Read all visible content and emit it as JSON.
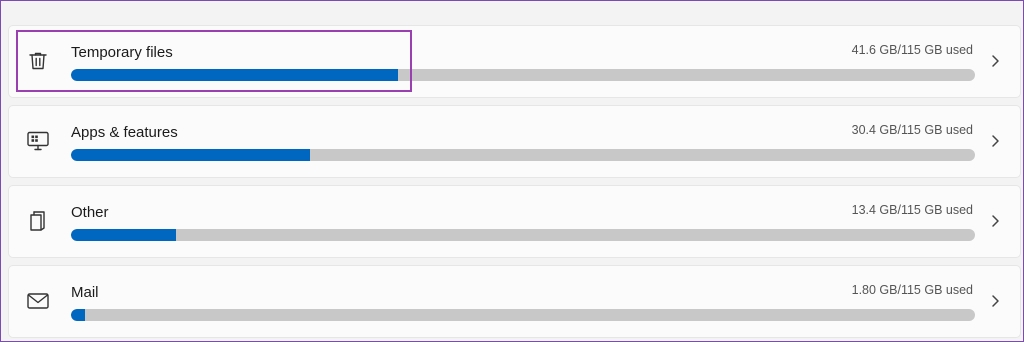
{
  "rows": [
    {
      "label": "Temporary files",
      "usage": "41.6 GB/115 GB used",
      "fraction": 0.3617,
      "icon": "trash-icon"
    },
    {
      "label": "Apps & features",
      "usage": "30.4 GB/115 GB used",
      "fraction": 0.2643,
      "icon": "apps-icon"
    },
    {
      "label": "Other",
      "usage": "13.4 GB/115 GB used",
      "fraction": 0.1165,
      "icon": "document-icon"
    },
    {
      "label": "Mail",
      "usage": "1.80 GB/115 GB used",
      "fraction": 0.0157,
      "icon": "mail-icon"
    }
  ],
  "colors": {
    "accent": "#0067c0",
    "track": "#c8c8c8",
    "highlight": "#9a3fb0"
  },
  "chevron_icon": "chevron-right-icon"
}
